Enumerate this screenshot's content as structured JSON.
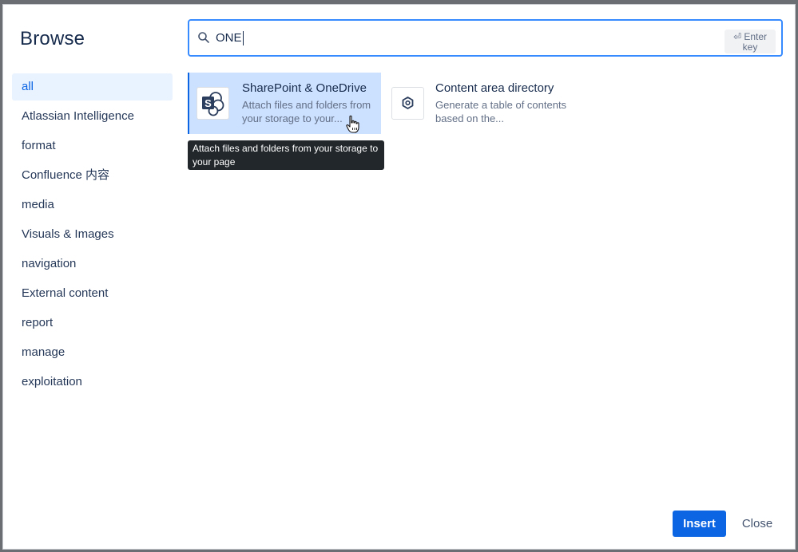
{
  "dialog": {
    "title": "Browse"
  },
  "search": {
    "value": "ONE",
    "enter_hint_line1": "⏎ Enter",
    "enter_hint_line2": "key"
  },
  "sidebar": {
    "items": [
      {
        "label": "all",
        "active": true
      },
      {
        "label": "Atlassian Intelligence"
      },
      {
        "label": "format"
      },
      {
        "label": "Confluence 内容"
      },
      {
        "label": "media"
      },
      {
        "label": "Visuals & Images"
      },
      {
        "label": "navigation"
      },
      {
        "label": "External content"
      },
      {
        "label": "report"
      },
      {
        "label": "manage"
      },
      {
        "label": "exploitation"
      }
    ]
  },
  "results": [
    {
      "title": "SharePoint & OneDrive",
      "description": "Attach files and folders from your storage to your...",
      "icon": "sharepoint-icon",
      "selected": true
    },
    {
      "title": "Content area directory",
      "description": "Generate a table of contents based on the...",
      "icon": "hexagon-icon",
      "selected": false
    }
  ],
  "tooltip": {
    "text": "Attach files and folders from your storage to your page"
  },
  "footer": {
    "insert_label": "Insert",
    "close_label": "Close"
  },
  "colors": {
    "accent": "#0c66e4",
    "selected_bg": "#cce0ff",
    "sidebar_active_bg": "#e9f2ff",
    "tooltip_bg": "#22272b"
  }
}
